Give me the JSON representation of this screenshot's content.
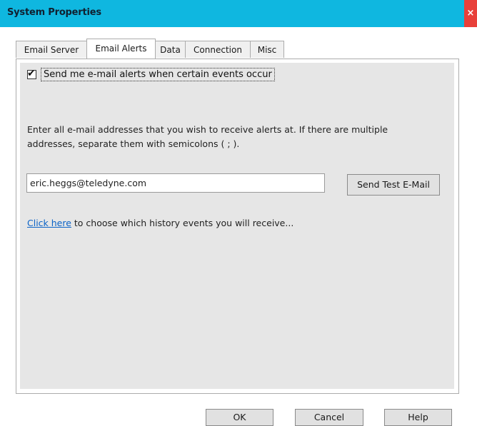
{
  "window": {
    "title": "System Properties",
    "close_symbol": "×"
  },
  "tabs": [
    {
      "label": "Email Server",
      "active": false
    },
    {
      "label": "Email Alerts",
      "active": true
    },
    {
      "label": "Data",
      "active": false
    },
    {
      "label": "Connection",
      "active": false
    },
    {
      "label": "Misc",
      "active": false
    }
  ],
  "email_alerts": {
    "checkbox_label": "Send me e-mail alerts when certain events occur",
    "checkbox_checked": true,
    "checkmark_glyph": "✔",
    "instructions": "Enter all e-mail addresses that you wish to receive alerts at. If there are multiple addresses, separate them with semicolons ( ; ).",
    "email_value": "eric.heggs@teledyne.com",
    "send_test_label": "Send Test E-Mail",
    "link_text": "Click here",
    "link_suffix": " to choose which history events you will receive..."
  },
  "footer": {
    "ok_label": "OK",
    "cancel_label": "Cancel",
    "help_label": "Help"
  },
  "colors": {
    "titlebar": "#0fb7e0",
    "close_button": "#e8403a",
    "panel_background": "#e6e6e6",
    "link": "#0b63c7"
  }
}
